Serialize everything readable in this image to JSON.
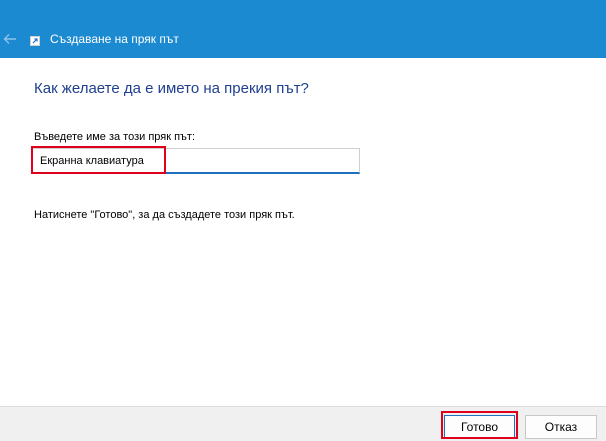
{
  "window": {
    "title": "Създаване на пряк път",
    "back_icon": "back-arrow-icon",
    "app_icon": "shortcut-app-icon"
  },
  "main": {
    "heading": "Как желаете да е името на прекия път?",
    "field_label": "Въведете име за този пряк път:",
    "shortcut_name_value": "Екранна клавиатура",
    "hint": "Натиснете \"Готово\", за да създадете този пряк път."
  },
  "footer": {
    "done_label": "Готово",
    "cancel_label": "Отказ"
  },
  "colors": {
    "titlebar": "#1b8ad1",
    "heading": "#1f3f8f",
    "highlight": "#e0001b",
    "input_underline": "#1f6fbf"
  }
}
